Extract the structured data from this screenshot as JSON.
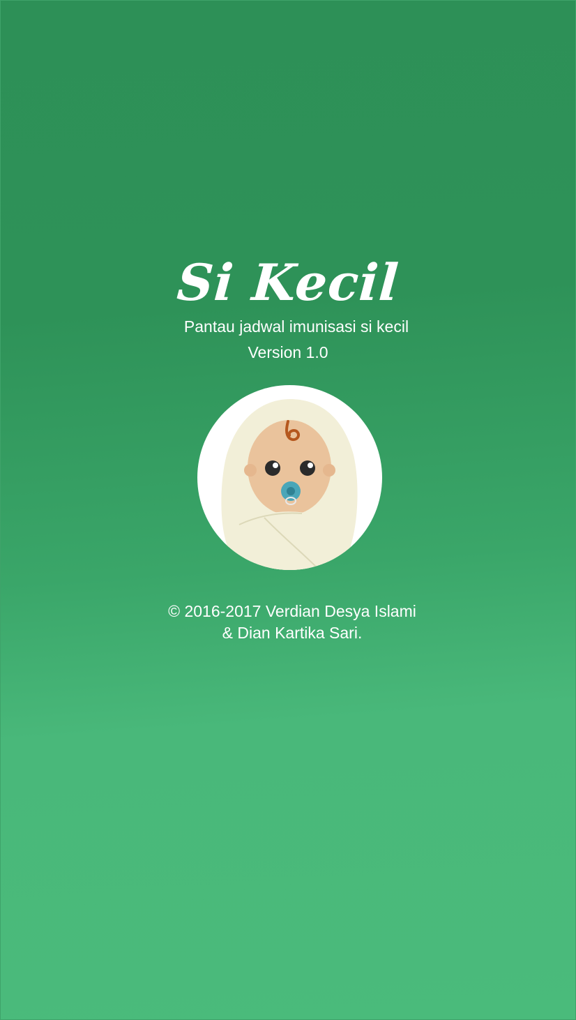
{
  "splash": {
    "app_title": "Si Kecil",
    "tagline": "Pantau jadwal imunisasi si kecil",
    "version": "Version 1.0",
    "copyright_line1": "© 2016-2017 Verdian Desya Islami",
    "copyright_line2": "& Dian Kartika Sari.",
    "logo_icon": "baby-icon"
  },
  "colors": {
    "background_top": "#2d9057",
    "background_bottom": "#4abb7b",
    "text": "#ffffff",
    "circle": "#ffffff",
    "blanket": "#f2efd8",
    "skin": "#eac39c",
    "pacifier": "#4aa6b8",
    "hair": "#b5571e"
  }
}
